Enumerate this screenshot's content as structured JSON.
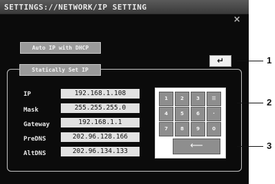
{
  "window": {
    "title": "SETTINGS://NETWORK/IP SETTING",
    "close_icon": "×"
  },
  "buttons": {
    "dhcp_label": "Auto IP with DHCP",
    "static_label": "Statically Set IP",
    "enter_icon": "↵"
  },
  "fields": [
    {
      "label": "IP",
      "value": "192.168.1.108"
    },
    {
      "label": "Mask",
      "value": "255.255.255.0"
    },
    {
      "label": "Gateway",
      "value": "192.168.1.1"
    },
    {
      "label": "PreDNS",
      "value": "202.96.128.166"
    },
    {
      "label": "AltDNS",
      "value": "202.96.134.133"
    }
  ],
  "keypad": {
    "keys": [
      "1",
      "2",
      "3",
      "☰",
      "4",
      "5",
      "6",
      "·",
      "7",
      "8",
      "9",
      "0"
    ],
    "backspace_icon": "⟵"
  },
  "callouts": [
    "1",
    "2",
    "3"
  ]
}
